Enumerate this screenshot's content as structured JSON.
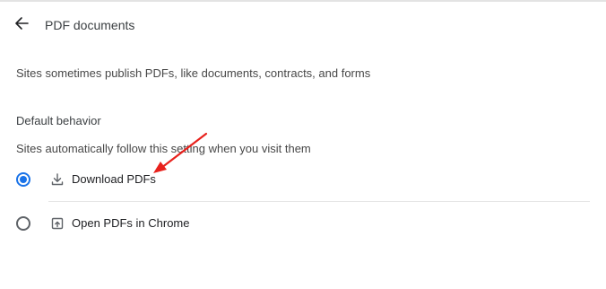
{
  "header": {
    "back_icon": "arrow-back-icon",
    "title": "PDF documents"
  },
  "description": "Sites sometimes publish PDFs, like documents, contracts, and forms",
  "default_behavior": {
    "title": "Default behavior",
    "subtitle": "Sites automatically follow this setting when you visit them",
    "options": [
      {
        "label": "Download PDFs",
        "icon": "download-icon",
        "selected": true
      },
      {
        "label": "Open PDFs in Chrome",
        "icon": "open-in-chrome-icon",
        "selected": false
      }
    ]
  },
  "colors": {
    "accent": "#1a73e8",
    "annotation_arrow": "#e8211c"
  }
}
